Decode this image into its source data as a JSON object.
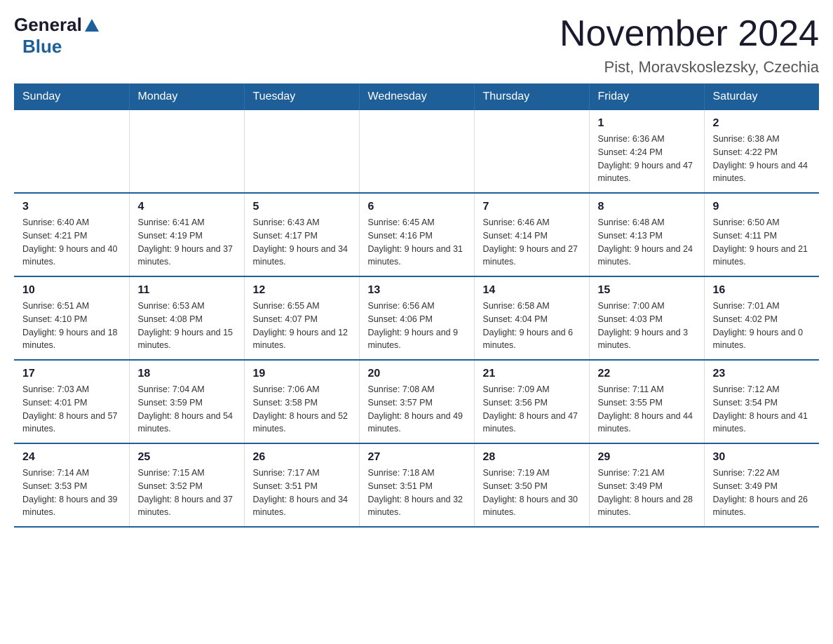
{
  "header": {
    "logo_general": "General",
    "logo_blue": "Blue",
    "main_title": "November 2024",
    "subtitle": "Pist, Moravskoslezsky, Czechia"
  },
  "weekdays": [
    "Sunday",
    "Monday",
    "Tuesday",
    "Wednesday",
    "Thursday",
    "Friday",
    "Saturday"
  ],
  "weeks": [
    [
      {
        "day": "",
        "info": ""
      },
      {
        "day": "",
        "info": ""
      },
      {
        "day": "",
        "info": ""
      },
      {
        "day": "",
        "info": ""
      },
      {
        "day": "",
        "info": ""
      },
      {
        "day": "1",
        "info": "Sunrise: 6:36 AM\nSunset: 4:24 PM\nDaylight: 9 hours and 47 minutes."
      },
      {
        "day": "2",
        "info": "Sunrise: 6:38 AM\nSunset: 4:22 PM\nDaylight: 9 hours and 44 minutes."
      }
    ],
    [
      {
        "day": "3",
        "info": "Sunrise: 6:40 AM\nSunset: 4:21 PM\nDaylight: 9 hours and 40 minutes."
      },
      {
        "day": "4",
        "info": "Sunrise: 6:41 AM\nSunset: 4:19 PM\nDaylight: 9 hours and 37 minutes."
      },
      {
        "day": "5",
        "info": "Sunrise: 6:43 AM\nSunset: 4:17 PM\nDaylight: 9 hours and 34 minutes."
      },
      {
        "day": "6",
        "info": "Sunrise: 6:45 AM\nSunset: 4:16 PM\nDaylight: 9 hours and 31 minutes."
      },
      {
        "day": "7",
        "info": "Sunrise: 6:46 AM\nSunset: 4:14 PM\nDaylight: 9 hours and 27 minutes."
      },
      {
        "day": "8",
        "info": "Sunrise: 6:48 AM\nSunset: 4:13 PM\nDaylight: 9 hours and 24 minutes."
      },
      {
        "day": "9",
        "info": "Sunrise: 6:50 AM\nSunset: 4:11 PM\nDaylight: 9 hours and 21 minutes."
      }
    ],
    [
      {
        "day": "10",
        "info": "Sunrise: 6:51 AM\nSunset: 4:10 PM\nDaylight: 9 hours and 18 minutes."
      },
      {
        "day": "11",
        "info": "Sunrise: 6:53 AM\nSunset: 4:08 PM\nDaylight: 9 hours and 15 minutes."
      },
      {
        "day": "12",
        "info": "Sunrise: 6:55 AM\nSunset: 4:07 PM\nDaylight: 9 hours and 12 minutes."
      },
      {
        "day": "13",
        "info": "Sunrise: 6:56 AM\nSunset: 4:06 PM\nDaylight: 9 hours and 9 minutes."
      },
      {
        "day": "14",
        "info": "Sunrise: 6:58 AM\nSunset: 4:04 PM\nDaylight: 9 hours and 6 minutes."
      },
      {
        "day": "15",
        "info": "Sunrise: 7:00 AM\nSunset: 4:03 PM\nDaylight: 9 hours and 3 minutes."
      },
      {
        "day": "16",
        "info": "Sunrise: 7:01 AM\nSunset: 4:02 PM\nDaylight: 9 hours and 0 minutes."
      }
    ],
    [
      {
        "day": "17",
        "info": "Sunrise: 7:03 AM\nSunset: 4:01 PM\nDaylight: 8 hours and 57 minutes."
      },
      {
        "day": "18",
        "info": "Sunrise: 7:04 AM\nSunset: 3:59 PM\nDaylight: 8 hours and 54 minutes."
      },
      {
        "day": "19",
        "info": "Sunrise: 7:06 AM\nSunset: 3:58 PM\nDaylight: 8 hours and 52 minutes."
      },
      {
        "day": "20",
        "info": "Sunrise: 7:08 AM\nSunset: 3:57 PM\nDaylight: 8 hours and 49 minutes."
      },
      {
        "day": "21",
        "info": "Sunrise: 7:09 AM\nSunset: 3:56 PM\nDaylight: 8 hours and 47 minutes."
      },
      {
        "day": "22",
        "info": "Sunrise: 7:11 AM\nSunset: 3:55 PM\nDaylight: 8 hours and 44 minutes."
      },
      {
        "day": "23",
        "info": "Sunrise: 7:12 AM\nSunset: 3:54 PM\nDaylight: 8 hours and 41 minutes."
      }
    ],
    [
      {
        "day": "24",
        "info": "Sunrise: 7:14 AM\nSunset: 3:53 PM\nDaylight: 8 hours and 39 minutes."
      },
      {
        "day": "25",
        "info": "Sunrise: 7:15 AM\nSunset: 3:52 PM\nDaylight: 8 hours and 37 minutes."
      },
      {
        "day": "26",
        "info": "Sunrise: 7:17 AM\nSunset: 3:51 PM\nDaylight: 8 hours and 34 minutes."
      },
      {
        "day": "27",
        "info": "Sunrise: 7:18 AM\nSunset: 3:51 PM\nDaylight: 8 hours and 32 minutes."
      },
      {
        "day": "28",
        "info": "Sunrise: 7:19 AM\nSunset: 3:50 PM\nDaylight: 8 hours and 30 minutes."
      },
      {
        "day": "29",
        "info": "Sunrise: 7:21 AM\nSunset: 3:49 PM\nDaylight: 8 hours and 28 minutes."
      },
      {
        "day": "30",
        "info": "Sunrise: 7:22 AM\nSunset: 3:49 PM\nDaylight: 8 hours and 26 minutes."
      }
    ]
  ]
}
